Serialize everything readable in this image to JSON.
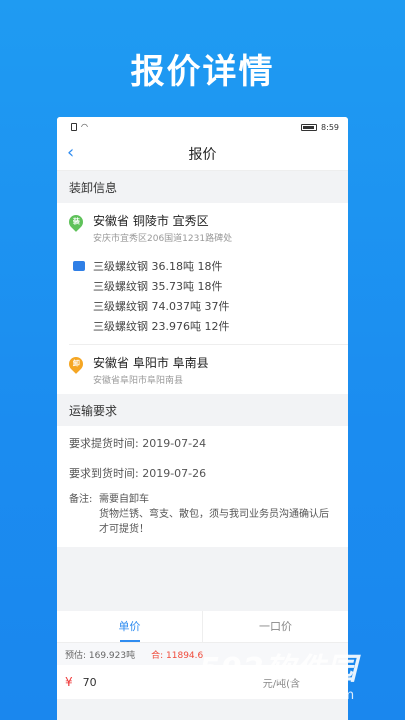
{
  "hero": {
    "title": "报价详情"
  },
  "status_bar": {
    "time": "8:59"
  },
  "nav": {
    "title": "报价"
  },
  "loading": {
    "section_title": "装卸信息",
    "origin": {
      "address": "安徽省 铜陵市 宜秀区",
      "detail": "安庆市宜秀区206国道1231路碑处"
    },
    "goods": [
      "三级螺纹钢 36.18吨 18件",
      "三级螺纹钢 35.73吨 18件",
      "三级螺纹钢 74.037吨 37件",
      "三级螺纹钢 23.976吨 12件"
    ],
    "destination": {
      "address": "安徽省 阜阳市 阜南县",
      "detail": "安徽省阜阳市阜阳南县"
    }
  },
  "requirements": {
    "section_title": "运输要求",
    "pickup": "要求提货时间: 2019-07-24",
    "arrival": "要求到货时间: 2019-07-26",
    "note_label": "备注:",
    "note_text": "需要自卸车\n货物烂锈、弯支、散包，须与我司业务员沟通确认后才可提货！"
  },
  "quote": {
    "tabs": [
      "单价",
      "一口价"
    ],
    "estimate_weight": "预估: 169.923吨",
    "estimate_total": "合: 11894.6",
    "currency_symbol": "¥",
    "price_value": "70",
    "price_unit": "元/吨(含"
  },
  "watermark": {
    "brand": "592软件园",
    "url": "www.592xiazai.com"
  },
  "colors": {
    "accent": "#2f8cf0",
    "background": "#1b8cf0"
  }
}
